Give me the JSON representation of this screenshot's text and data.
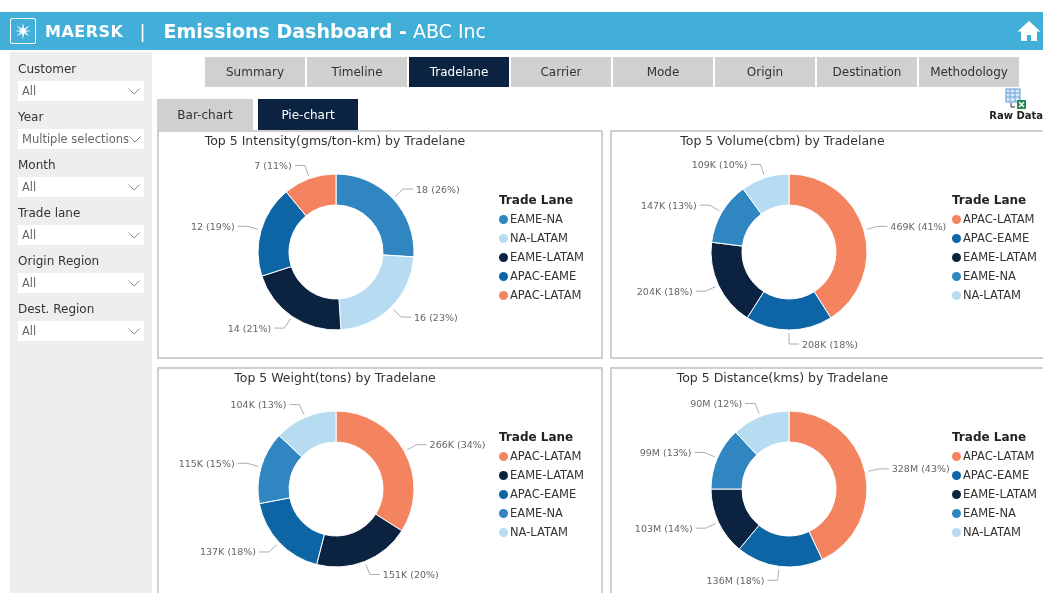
{
  "header": {
    "brand": "MAERSK",
    "separator": "|",
    "title": "**Emissions Dashboard -** ABC Inc"
  },
  "filters": [
    {
      "label": "Customer",
      "value": "All"
    },
    {
      "label": "Year",
      "value": "Multiple selections"
    },
    {
      "label": "Month",
      "value": "All"
    },
    {
      "label": "Trade lane",
      "value": "All"
    },
    {
      "label": "Origin Region",
      "value": "All"
    },
    {
      "label": "Dest. Region",
      "value": "All"
    }
  ],
  "tabs": [
    {
      "label": "Summary",
      "selected": false
    },
    {
      "label": "Timeline",
      "selected": false
    },
    {
      "label": "Tradelane",
      "selected": true
    },
    {
      "label": "Carrier",
      "selected": false
    },
    {
      "label": "Mode",
      "selected": false
    },
    {
      "label": "Origin",
      "selected": false
    },
    {
      "label": "Destination",
      "selected": false
    },
    {
      "label": "Methodology",
      "selected": false
    }
  ],
  "subtabs": [
    {
      "label": "Bar-chart",
      "selected": false
    },
    {
      "label": "Pie-chart",
      "selected": true
    }
  ],
  "raw_data": "Raw Data",
  "charts": [
    {
      "legend_title": "Trade Lane",
      "legend": [
        {
          "label": "EAME-NA",
          "color": "#2f86c0"
        },
        {
          "label": "NA-LATAM",
          "color": "#b7dcf2"
        },
        {
          "label": "EAME-LATAM",
          "color": "#0b2340"
        },
        {
          "label": "APAC-EAME",
          "color": "#0d65a6"
        },
        {
          "label": "APAC-LATAM",
          "color": "#f4845f"
        }
      ],
      "chart_data": {
        "type": "donut",
        "title": "Top 5 Intensity(gms/ton-km) by Tradelane",
        "values": [
          26,
          23,
          21,
          19,
          11
        ],
        "value_labels": [
          "18 (26%)",
          "16 (23%)",
          "14 (21%)",
          "12 (19%)",
          "7 (11%)"
        ]
      }
    },
    {
      "legend_title": "Trade Lane",
      "legend": [
        {
          "label": "APAC-LATAM",
          "color": "#f4845f"
        },
        {
          "label": "APAC-EAME",
          "color": "#0d65a6"
        },
        {
          "label": "EAME-LATAM",
          "color": "#0b2340"
        },
        {
          "label": "EAME-NA",
          "color": "#2f86c0"
        },
        {
          "label": "NA-LATAM",
          "color": "#b7dcf2"
        }
      ],
      "chart_data": {
        "type": "donut",
        "title": "Top 5 Volume(cbm) by Tradelane",
        "values": [
          41,
          18,
          18,
          13,
          10
        ],
        "value_labels": [
          "469K (41%)",
          "208K (18%)",
          "204K (18%)",
          "147K (13%)",
          "109K (10%)"
        ]
      }
    },
    {
      "legend_title": "Trade Lane",
      "legend": [
        {
          "label": "APAC-LATAM",
          "color": "#f4845f"
        },
        {
          "label": "EAME-LATAM",
          "color": "#0b2340"
        },
        {
          "label": "APAC-EAME",
          "color": "#0d65a6"
        },
        {
          "label": "EAME-NA",
          "color": "#2f86c0"
        },
        {
          "label": "NA-LATAM",
          "color": "#b7dcf2"
        }
      ],
      "chart_data": {
        "type": "donut",
        "title": "Top 5 Weight(tons) by Tradelane",
        "values": [
          34,
          20,
          18,
          15,
          13
        ],
        "value_labels": [
          "266K (34%)",
          "151K (20%)",
          "137K (18%)",
          "115K (15%)",
          "104K (13%)"
        ]
      }
    },
    {
      "legend_title": "Trade Lane",
      "legend": [
        {
          "label": "APAC-LATAM",
          "color": "#f4845f"
        },
        {
          "label": "APAC-EAME",
          "color": "#0d65a6"
        },
        {
          "label": "EAME-LATAM",
          "color": "#0b2340"
        },
        {
          "label": "EAME-NA",
          "color": "#2f86c0"
        },
        {
          "label": "NA-LATAM",
          "color": "#b7dcf2"
        }
      ],
      "chart_data": {
        "type": "donut",
        "title": "Top 5 Distance(kms) by Tradelane",
        "values": [
          43,
          18,
          14,
          13,
          12
        ],
        "value_labels": [
          "328M (43%)",
          "136M (18%)",
          "103M (14%)",
          "99M (13%)",
          "90M (12%)"
        ]
      }
    }
  ]
}
